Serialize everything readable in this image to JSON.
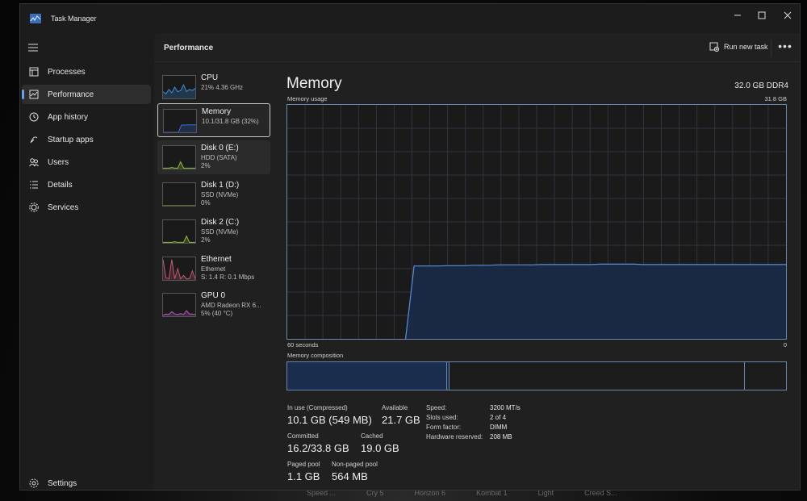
{
  "window": {
    "title": "Task Manager",
    "controls": [
      "—",
      "☐",
      "✕"
    ]
  },
  "sidebar": {
    "items": [
      {
        "label": "Processes",
        "icon": "processes-icon"
      },
      {
        "label": "Performance",
        "icon": "performance-icon",
        "active": true
      },
      {
        "label": "App history",
        "icon": "history-icon"
      },
      {
        "label": "Startup apps",
        "icon": "startup-icon"
      },
      {
        "label": "Users",
        "icon": "users-icon"
      },
      {
        "label": "Details",
        "icon": "details-icon"
      },
      {
        "label": "Services",
        "icon": "services-icon"
      }
    ],
    "settings": "Settings"
  },
  "header": {
    "title": "Performance",
    "run_new_task": "Run new task",
    "more": "•••"
  },
  "devices": [
    {
      "name": "CPU",
      "line2": "21% 4.36 GHz",
      "line3": "",
      "color": "#3c8fd6"
    },
    {
      "name": "Memory",
      "line2": "10.1/31.8 GB (32%)",
      "line3": "",
      "color": "#3c6fd6",
      "selected": true
    },
    {
      "name": "Disk 0 (E:)",
      "line2": "HDD (SATA)",
      "line3": "2%",
      "color": "#8fbf3c"
    },
    {
      "name": "Disk 1 (D:)",
      "line2": "SSD (NVMe)",
      "line3": "0%",
      "color": "#8fbf3c"
    },
    {
      "name": "Disk 2 (C:)",
      "line2": "SSD (NVMe)",
      "line3": "2%",
      "color": "#8fbf3c"
    },
    {
      "name": "Ethernet",
      "line2": "Ethernet",
      "line3": "S: 1.4 R: 0.1 Mbps",
      "color": "#c05a72"
    },
    {
      "name": "GPU 0",
      "line2": "AMD Radeon RX 6...",
      "line3": "5% (40 °C)",
      "color": "#b05ab8"
    }
  ],
  "memory": {
    "title": "Memory",
    "spec": "32.0 GB DDR4",
    "usage_label": "Memory usage",
    "usage_max": "31.8 GB",
    "axis_left": "60 seconds",
    "axis_right": "0",
    "composition_label": "Memory composition",
    "stats": {
      "in_use_label": "In use (Compressed)",
      "in_use_value": "10.1 GB (549 MB)",
      "available_label": "Available",
      "available_value": "21.7 GB",
      "committed_label": "Committed",
      "committed_value": "16.2/33.8 GB",
      "cached_label": "Cached",
      "cached_value": "19.0 GB",
      "paged_label": "Paged pool",
      "paged_value": "1.1 GB",
      "nonpaged_label": "Non-paged pool",
      "nonpaged_value": "564 MB"
    },
    "details": [
      {
        "k": "Speed:",
        "v": "3200 MT/s"
      },
      {
        "k": "Slots used:",
        "v": "2 of 4"
      },
      {
        "k": "Form factor:",
        "v": "DIMM"
      },
      {
        "k": "Hardware reserved:",
        "v": "208 MB"
      }
    ]
  },
  "taskbar_ghost": [
    "Speed ...",
    "Cry 5",
    "Horizon 6",
    "Kombat 1",
    "Light",
    "Creed S..."
  ],
  "chart_data": {
    "type": "area",
    "title": "Memory usage",
    "xlabel": "",
    "ylabel": "",
    "x_range_seconds": [
      60,
      0
    ],
    "ylim": [
      0,
      31.8
    ],
    "unit": "GB",
    "series": [
      {
        "values": [
          null,
          null,
          null,
          null,
          null,
          null,
          null,
          null,
          null,
          null,
          null,
          null,
          null,
          null,
          0,
          9.9,
          9.9,
          9.9,
          9.9,
          9.95,
          9.95,
          9.95,
          10.0,
          10.0,
          10.0,
          10.05,
          10.05,
          10.05,
          10.05,
          10.05,
          10.1,
          10.1,
          10.1,
          10.1,
          10.1,
          10.1,
          10.1,
          10.15,
          10.15,
          10.15,
          10.15,
          10.15,
          10.1,
          10.1,
          10.1,
          10.1,
          10.1,
          10.1,
          10.1,
          10.1,
          10.1,
          10.1,
          10.1,
          10.1,
          10.1,
          10.1,
          10.1,
          10.1,
          10.1,
          10.1
        ]
      }
    ],
    "composition": {
      "in_use_gb": 10.1,
      "modified_gb": 0.15,
      "standby_gb": 19.0,
      "free_gb": 2.6
    }
  }
}
